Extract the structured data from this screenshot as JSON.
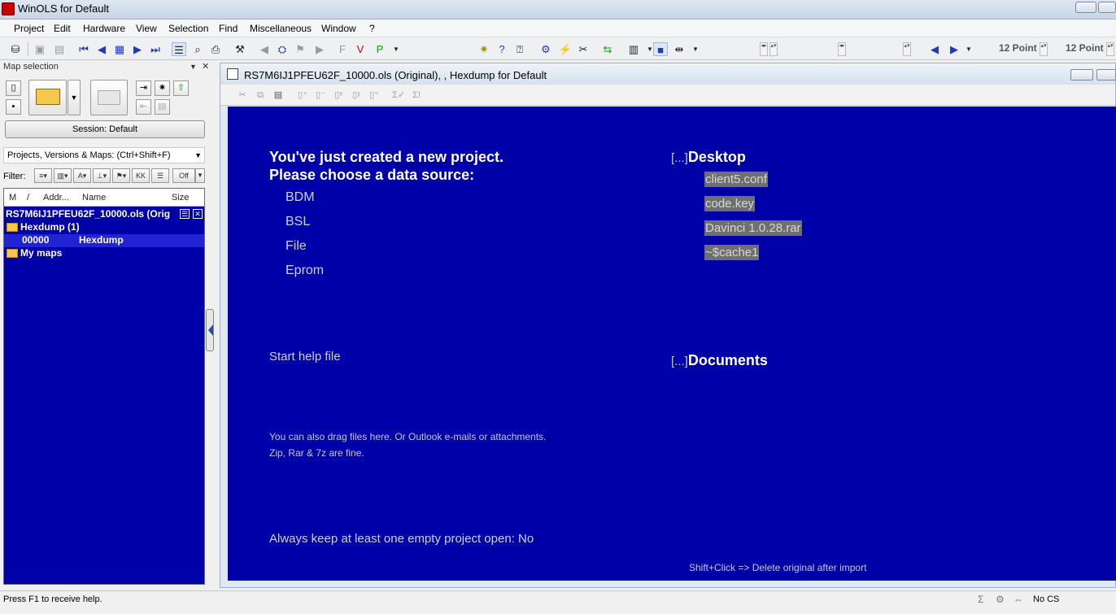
{
  "window": {
    "title": "WinOLS for Default"
  },
  "menu": [
    "Project",
    "Edit",
    "Hardware",
    "View",
    "Selection",
    "Find",
    "Miscellaneous",
    "Window",
    "?"
  ],
  "toolbar": {
    "font_size_1": "12 Point",
    "font_size_2": "12 Point"
  },
  "left_panel": {
    "header": "Map selection",
    "session_button": "Session: Default",
    "combo_value": "Projects, Versions & Maps:  (Ctrl+Shift+F)",
    "filter_label": "Filter:",
    "filter_off": "Off",
    "columns": [
      "M",
      "/",
      "Addr...",
      "Name",
      "Size"
    ],
    "tree": {
      "project": "RS7M6IJ1PFEU62F_10000.ols (Orig",
      "folder_hexdump": "Hexdump (1)",
      "row_addr": "00000",
      "row_name": "Hexdump",
      "folder_mymaps": "My maps"
    }
  },
  "child_window": {
    "title": "RS7M6IJ1PFEU62F_10000.ols (Original), , Hexdump for Default"
  },
  "content": {
    "heading_line1": "You've just created a new project.",
    "heading_line2": "Please choose a data source:",
    "sources": [
      "BDM",
      "BSL",
      "File",
      "Eprom"
    ],
    "help_link": "Start help file",
    "drag_note_line1": "You can also drag files here. Or Outlook e-mails or attachments.",
    "drag_note_line2": "Zip, Rar & 7z are fine.",
    "keep_empty": "Always keep at least one empty project open: No",
    "desktop_bracket": "[...]",
    "desktop_label": "Desktop",
    "desktop_files": [
      "client5.conf",
      "code.key",
      "Davinci 1.0.28.rar",
      "~$cache1"
    ],
    "documents_bracket": "[...]",
    "documents_label": "Documents",
    "shift_note": "Shift+Click => Delete original after import"
  },
  "statusbar": {
    "message": "Press F1 to receive help.",
    "cs": "No CS"
  },
  "colors": {
    "content_bg": "#0000a8",
    "file_highlight": "#6f6f6f"
  }
}
